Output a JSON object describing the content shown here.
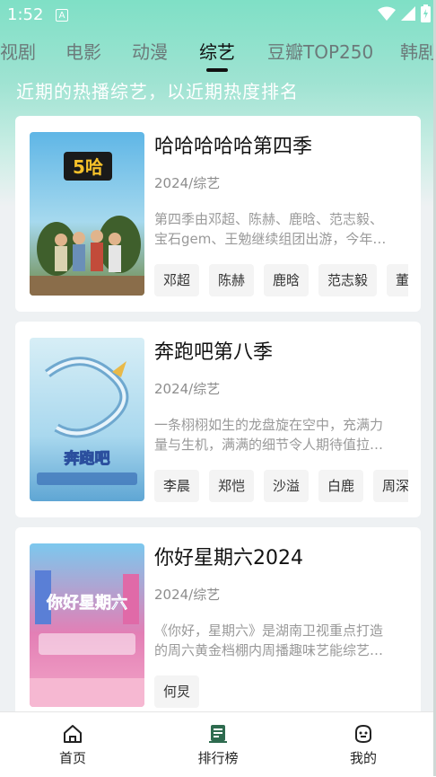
{
  "status": {
    "time": "1:52",
    "notification_letter": "A"
  },
  "tabs": [
    {
      "label": "视剧",
      "active": false
    },
    {
      "label": "电影",
      "active": false
    },
    {
      "label": "动漫",
      "active": false
    },
    {
      "label": "综艺",
      "active": true
    },
    {
      "label": "豆瓣TOP250",
      "active": false
    },
    {
      "label": "韩剧",
      "active": false
    }
  ],
  "subtitle": "近期的热播综艺，以近期热度排名",
  "cards": [
    {
      "title": "哈哈哈哈哈第四季",
      "meta": "2024/综艺",
      "desc_line1": "第四季由邓超、陈赫、鹿晗、范志毅、",
      "desc_line2": "宝石gem、王勉继续组团出游，今年…",
      "chips": [
        "邓超",
        "陈赫",
        "鹿晗",
        "范志毅",
        "董"
      ]
    },
    {
      "title": "奔跑吧第八季",
      "meta": "2024/综艺",
      "desc_line1": "一条栩栩如生的龙盘旋在空中，充满力",
      "desc_line2": "量与生机，满满的细节令人期待值拉…",
      "chips": [
        "李晨",
        "郑恺",
        "沙溢",
        "白鹿",
        "周深"
      ]
    },
    {
      "title": "你好星期六2024",
      "meta": "2024/综艺",
      "desc_line1": "《你好，星期六》是湖南卫视重点打造",
      "desc_line2": "的周六黄金档棚内周播趣味艺能综艺…",
      "chips": [
        "何炅"
      ]
    }
  ],
  "posters": {
    "p1_text": "5哈",
    "p2_text": "奔跑吧",
    "p3_text": "你好星期六"
  },
  "nav": [
    {
      "label": "首页",
      "icon": "home-icon"
    },
    {
      "label": "排行榜",
      "icon": "ranking-icon"
    },
    {
      "label": "我的",
      "icon": "profile-icon"
    }
  ]
}
